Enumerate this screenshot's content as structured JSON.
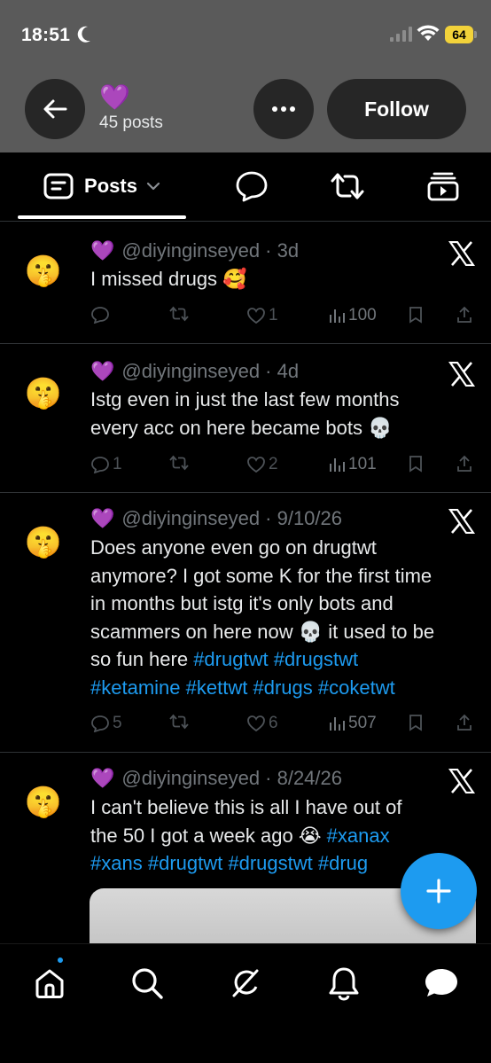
{
  "status_bar": {
    "time": "18:51",
    "battery": "64"
  },
  "profile": {
    "name_emoji": "💜",
    "post_count": "45 posts",
    "follow_label": "Follow"
  },
  "tabs": [
    {
      "label": "Posts",
      "icon": "posts-icon",
      "selected": true
    },
    {
      "label": "",
      "icon": "replies-icon"
    },
    {
      "label": "",
      "icon": "reposts-icon"
    },
    {
      "label": "",
      "icon": "media-icon"
    }
  ],
  "posts": [
    {
      "avatar": "🤫",
      "name_emoji": "💜",
      "meta": "@diyinginseyed · 3d",
      "lines": [
        "I missed drugs 🥰"
      ],
      "replies": "",
      "likes": "1",
      "views": "100"
    },
    {
      "avatar": "🤫",
      "name_emoji": "💜",
      "meta": "@diyinginseyed · 4d",
      "lines": [
        "Istg even in just the last few months",
        "every acc on here became bots 💀"
      ],
      "replies": "1",
      "likes": "2",
      "views": "101"
    },
    {
      "avatar": "🤫",
      "name_emoji": "💜",
      "meta": "@diyinginseyed · 9/10/26",
      "lines": [
        "Does anyone even go on drugtwt",
        "anymore? I got some K for the first time",
        "in months but istg it's only bots and",
        "scammers on here now 💀 it used to be",
        "so fun here "
      ],
      "hashtags_line5": [
        "#drugtwt",
        "#drugstwt"
      ],
      "hashtags_line6": [
        "#ketamine",
        "#kettwt",
        "#drugs",
        "#coketwt"
      ],
      "replies": "5",
      "likes": "6",
      "views": "507"
    },
    {
      "avatar": "🤫",
      "name_emoji": "💜",
      "meta": "@diyinginseyed · 8/24/26",
      "lines": [
        "I can't believe this is all I have out of",
        "the 50 I got a week ago 😭 "
      ],
      "hashtags_line2": [
        "#xanax"
      ],
      "hashtags_line3": [
        "#xans",
        "#drugtwt",
        "#drugstwt",
        "#drug"
      ]
    }
  ],
  "colors": {
    "accent": "#1d9bf0",
    "heart": "#a052e8",
    "header_bg": "#5a5a5a"
  }
}
